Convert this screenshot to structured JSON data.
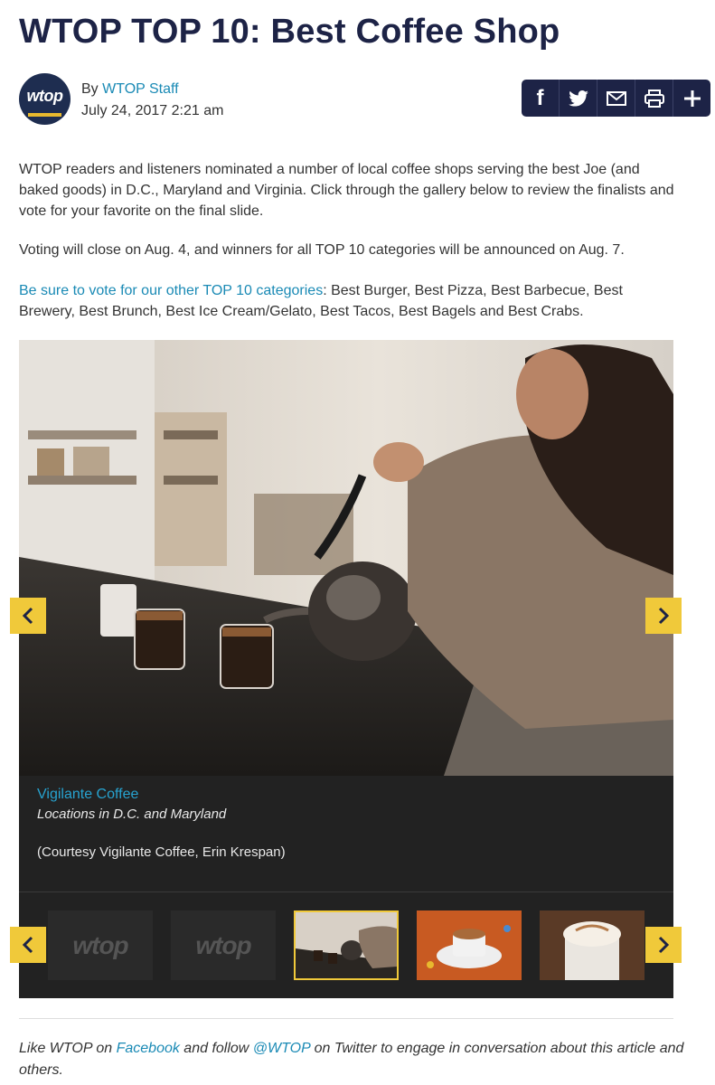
{
  "article": {
    "title": "WTOP TOP 10: Best Coffee Shop",
    "avatar_text": "wtop",
    "by_prefix": "By ",
    "author": "WTOP Staff",
    "date": "July 24, 2017 2:21 am"
  },
  "share": {
    "facebook": "f",
    "buttons": [
      "facebook-icon",
      "twitter-icon",
      "email-icon",
      "print-icon",
      "plus-icon"
    ]
  },
  "body": {
    "p1": "WTOP readers and listeners nominated a number of local coffee shops serving the best Joe (and baked goods) in D.C., Maryland and Virginia. Click through the gallery below to review the finalists and vote for your favorite on the final slide.",
    "p2": "Voting will close on Aug. 4, and winners for all TOP 10 categories will be announced on Aug. 7.",
    "p3_link": "Be sure to vote for our other TOP 10 categories",
    "p3_rest": ": Best Burger, Best Pizza, Best Barbecue, Best Brewery, Best Brunch, Best Ice Cream/Gelato, Best Tacos, Best Bagels and Best Crabs."
  },
  "gallery": {
    "caption_title": "Vigilante Coffee",
    "caption_subtitle": "Locations in D.C. and Maryland",
    "caption_credit": "(Courtesy Vigilante Coffee, Erin Krespan)",
    "thumb_logo_text": "wtop",
    "accent_color": "#f0c93a"
  },
  "footer": {
    "t1": "Like WTOP on ",
    "link1": "Facebook",
    "t2": " and follow ",
    "link2": "@WTOP",
    "t3": " on Twitter to engage in conversation about this article and others."
  },
  "colors": {
    "title": "#1d2346",
    "link": "#1a8ab5",
    "share_bar": "#1d2346"
  }
}
